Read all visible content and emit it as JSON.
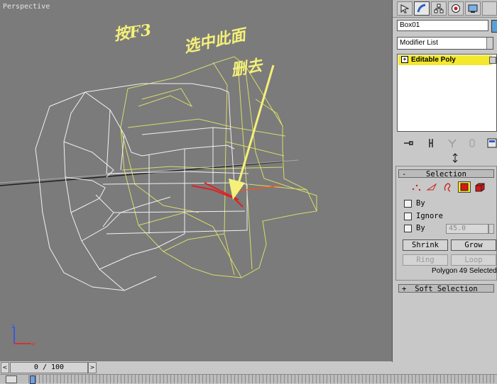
{
  "viewport": {
    "label": "Perspective",
    "annotations": [
      "按F3",
      "选中此面",
      "删去"
    ]
  },
  "timeline": {
    "frame_display": "0 / 100",
    "prev": "<",
    "next": ">"
  },
  "command_panel": {
    "tabs": [
      "create-icon",
      "modify-icon",
      "hierarchy-icon",
      "motion-icon",
      "display-icon"
    ],
    "object_name": "Box01",
    "object_color": "#5aa0d8",
    "modifier_list": "Modifier List",
    "stack": [
      {
        "label": "Editable Poly",
        "expand": "+",
        "highlight": "#f4e82e"
      }
    ],
    "stack_tools": [
      "pin-stack-icon",
      "show-end-result-icon",
      "make-unique-icon",
      "remove-modifier-icon",
      "configure-sets-icon"
    ]
  },
  "selection": {
    "title": "Selection",
    "collapse": "-",
    "levels": [
      "vertex-icon",
      "edge-icon",
      "border-icon",
      "polygon-icon",
      "element-icon"
    ],
    "active_level": "polygon-icon",
    "options": [
      {
        "label": "By",
        "checked": false
      },
      {
        "label": "Ignore",
        "checked": false
      },
      {
        "label": "By",
        "checked": false
      }
    ],
    "angle_value": "45.0",
    "buttons": {
      "shrink": "Shrink",
      "grow": "Grow",
      "ring": "Ring",
      "loop": "Loop"
    },
    "status": "Polygon 49 Selected"
  },
  "soft_selection": {
    "title": "Soft Selection",
    "expand": "+"
  }
}
